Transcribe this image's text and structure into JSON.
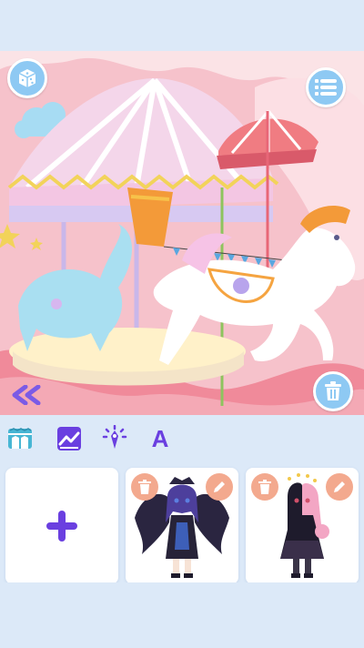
{
  "app": {
    "colors": {
      "background": "#dce9f8",
      "button_blue": "#8ec9f3",
      "accent_purple": "#6a3fe0",
      "action_orange": "#f3a98e",
      "scene_pink": "#f6c2cb"
    }
  },
  "scene": {
    "description_icon": "carousel-scene",
    "buttons": {
      "random_icon": "dice-icon",
      "menu_icon": "list-icon",
      "delete_icon": "trash-icon",
      "collapse_icon": "double-chevron-left-icon"
    }
  },
  "toolbar": {
    "tools": [
      {
        "icon": "background-tool-icon"
      },
      {
        "icon": "image-tool-icon"
      },
      {
        "icon": "effects-tool-icon"
      },
      {
        "icon": "text-tool-icon",
        "label": "A"
      }
    ]
  },
  "characters": {
    "add_icon": "plus-icon",
    "items": [
      {
        "icon": "character-dark-angel",
        "delete_icon": "trash-icon",
        "edit_icon": "pencil-icon"
      },
      {
        "icon": "character-gothic-girl",
        "delete_icon": "trash-icon",
        "edit_icon": "pencil-icon"
      }
    ]
  }
}
